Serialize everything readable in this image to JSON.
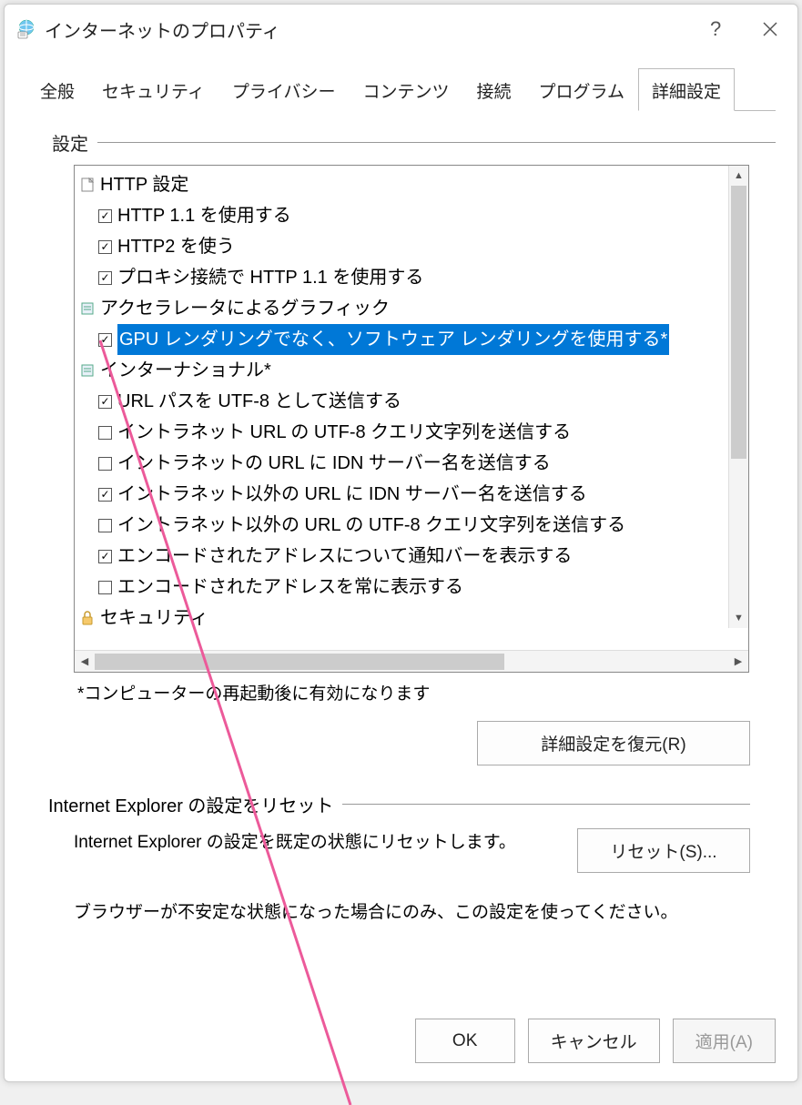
{
  "window": {
    "title": "インターネットのプロパティ"
  },
  "tabs": {
    "general": "全般",
    "security": "セキュリティ",
    "privacy": "プライバシー",
    "content": "コンテンツ",
    "connections": "接続",
    "programs": "プログラム",
    "advanced": "詳細設定"
  },
  "settings": {
    "label": "設定",
    "groups": [
      {
        "name": "HTTP 設定",
        "icon": "doc",
        "items": [
          {
            "label": "HTTP 1.1 を使用する",
            "checked": true,
            "selected": false
          },
          {
            "label": "HTTP2 を使う",
            "checked": true,
            "selected": false
          },
          {
            "label": "プロキシ接続で HTTP 1.1 を使用する",
            "checked": true,
            "selected": false
          }
        ]
      },
      {
        "name": "アクセラレータによるグラフィック",
        "icon": "sq",
        "items": [
          {
            "label": "GPU レンダリングでなく、ソフトウェア レンダリングを使用する*",
            "checked": true,
            "selected": true
          }
        ]
      },
      {
        "name": "インターナショナル*",
        "icon": "sq",
        "items": [
          {
            "label": "URL パスを UTF-8 として送信する",
            "checked": true,
            "selected": false
          },
          {
            "label": "イントラネット URL の UTF-8 クエリ文字列を送信する",
            "checked": false,
            "selected": false
          },
          {
            "label": "イントラネットの URL に IDN サーバー名を送信する",
            "checked": false,
            "selected": false
          },
          {
            "label": "イントラネット以外の URL に IDN サーバー名を送信する",
            "checked": true,
            "selected": false
          },
          {
            "label": "イントラネット以外の URL の UTF-8 クエリ文字列を送信する",
            "checked": false,
            "selected": false
          },
          {
            "label": "エンコードされたアドレスについて通知バーを表示する",
            "checked": true,
            "selected": false
          },
          {
            "label": "エンコードされたアドレスを常に表示する",
            "checked": false,
            "selected": false
          }
        ]
      },
      {
        "name": "セキュリティ",
        "icon": "lock",
        "items": []
      }
    ],
    "restart_note": "*コンピューターの再起動後に有効になります",
    "restore_button": "詳細設定を復元(R)"
  },
  "reset": {
    "label": "Internet Explorer の設定をリセット",
    "description": "Internet Explorer の設定を既定の状態にリセットします。",
    "button": "リセット(S)...",
    "warning": "ブラウザーが不安定な状態になった場合にのみ、この設定を使ってください。"
  },
  "buttons": {
    "ok": "OK",
    "cancel": "キャンセル",
    "apply": "適用(A)"
  }
}
